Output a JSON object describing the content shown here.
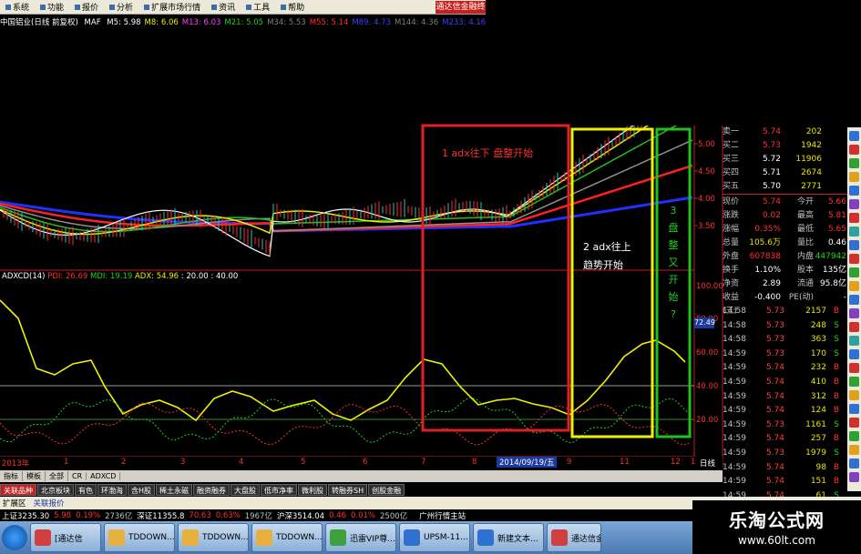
{
  "menu": {
    "items": [
      "系统",
      "功能",
      "报价",
      "分析",
      "扩展市场行情",
      "资讯",
      "工具",
      "帮助"
    ],
    "promo": "通达信金融终"
  },
  "ma_bar": {
    "title": "中国铝业(日线 前复权)",
    "type": "MAF",
    "items": [
      {
        "label": "M5: 5.98",
        "color": "#ffffff"
      },
      {
        "label": "M8: 6.06",
        "color": "#f0f000"
      },
      {
        "label": "M13: 6.03",
        "color": "#ff40ff"
      },
      {
        "label": "M21: 5.05",
        "color": "#20d020"
      },
      {
        "label": "M34: 5.53",
        "color": "#808080"
      },
      {
        "label": "M55: 5.14",
        "color": "#ff3030"
      },
      {
        "label": "M89: 4.73",
        "color": "#4040ff"
      },
      {
        "label": "M144: 4.36",
        "color": "#808080"
      },
      {
        "label": "M233: 4.16",
        "color": "#4040ff"
      }
    ]
  },
  "indicator": {
    "name": "ADXCD(14)",
    "pdi": "PDI: 26.69",
    "mdi": "MDI: 19.19",
    "adx": "ADX: 54.96",
    "extra": ": 20.00 : 40.00",
    "current": "72.49"
  },
  "annotations": {
    "a1": "1 adx往下 盘整开始",
    "a2_line1": "2 adx往上",
    "a2_line2": "趋势开始",
    "a3": [
      "3",
      "盘",
      "整",
      "又",
      "开",
      "始",
      "?"
    ]
  },
  "price_axis": [
    "5.00",
    "4.50",
    "4.00",
    "3.50"
  ],
  "ind_axis": [
    "100.00",
    "80.00",
    "60.00",
    "40.00",
    "20.00"
  ],
  "quotes": [
    {
      "k": "卖一",
      "p": "5.74",
      "v": "202",
      "pc": "#ff3030"
    },
    {
      "k": "买二",
      "p": "5.73",
      "v": "1942",
      "pc": "#ff3030"
    },
    {
      "k": "买三",
      "p": "5.72",
      "v": "11906",
      "pc": "#ffffff"
    },
    {
      "k": "买四",
      "p": "5.71",
      "v": "2674",
      "pc": "#ffffff"
    },
    {
      "k": "买五",
      "p": "5.70",
      "v": "2771",
      "pc": "#ffffff"
    }
  ],
  "stats": [
    {
      "k": "现价",
      "v": "5.74",
      "k2": "今开",
      "v2": "5.66"
    },
    {
      "k": "涨跌",
      "v": "0.02",
      "k2": "最高",
      "v2": "5.81"
    },
    {
      "k": "涨幅",
      "v": "0.35%",
      "k2": "最低",
      "v2": "5.65"
    },
    {
      "k": "总量",
      "v": "105.6万",
      "k2": "量比",
      "v2": "0.46"
    },
    {
      "k": "外盘",
      "v": "607838",
      "k2": "内盘",
      "v2": "447942"
    },
    {
      "k": "换手",
      "v": "1.10%",
      "k2": "股本",
      "v2": "135亿"
    },
    {
      "k": "净资",
      "v": "2.89",
      "k2": "流通",
      "v2": "95.8亿"
    },
    {
      "k": "收益(三)",
      "v": "-0.400",
      "k2": "PE(动)",
      "v2": "-"
    }
  ],
  "trades": [
    {
      "t": "14:58",
      "p": "5.73",
      "v": "2157",
      "s": "B"
    },
    {
      "t": "14:58",
      "p": "5.73",
      "v": "248",
      "s": "S"
    },
    {
      "t": "14:58",
      "p": "5.73",
      "v": "363",
      "s": "S"
    },
    {
      "t": "14:59",
      "p": "5.73",
      "v": "170",
      "s": "S"
    },
    {
      "t": "14:59",
      "p": "5.74",
      "v": "232",
      "s": "B"
    },
    {
      "t": "14:59",
      "p": "5.74",
      "v": "410",
      "s": "B"
    },
    {
      "t": "14:59",
      "p": "5.74",
      "v": "312",
      "s": "B"
    },
    {
      "t": "14:59",
      "p": "5.74",
      "v": "124",
      "s": "B"
    },
    {
      "t": "14:59",
      "p": "5.73",
      "v": "1161",
      "s": "S"
    },
    {
      "t": "14:59",
      "p": "5.74",
      "v": "257",
      "s": "B"
    },
    {
      "t": "14:59",
      "p": "5.73",
      "v": "1979",
      "s": "S"
    },
    {
      "t": "14:59",
      "p": "5.74",
      "v": "98",
      "s": "B"
    },
    {
      "t": "14:59",
      "p": "5.74",
      "v": "151",
      "s": "B"
    },
    {
      "t": "14:59",
      "p": "5.74",
      "v": "61",
      "s": "S"
    }
  ],
  "date_axis": {
    "start": "2013年",
    "months": [
      "1",
      "2",
      "3",
      "4",
      "5",
      "6",
      "7",
      "8",
      "9",
      "11",
      "12",
      "1"
    ],
    "cursor_date": "2014/09/19/五",
    "period": "日线"
  },
  "tabs1": [
    "指标",
    "模板",
    "全部",
    "CR",
    "ADXCD"
  ],
  "tabs2": [
    "关联品种",
    "北京板块",
    "有色",
    "环渤海",
    "含H股",
    "稀土永磁",
    "融资融券",
    "大盘股",
    "低市净率",
    "微利股",
    "转融券SH",
    "创股金融"
  ],
  "tabs3": [
    "扩展区",
    "关联报价"
  ],
  "status": [
    {
      "text": "上证3235.30",
      "color": "#ffffff"
    },
    {
      "text": "5.98",
      "color": "#ff3030"
    },
    {
      "text": "0.19%",
      "color": "#ff3030"
    },
    {
      "text": "2736亿",
      "color": "#c0c0c0"
    },
    {
      "text": "深证11355.8",
      "color": "#ffffff"
    },
    {
      "text": "70.63",
      "color": "#ff3030"
    },
    {
      "text": "0.63%",
      "color": "#ff3030"
    },
    {
      "text": "1967亿",
      "color": "#c0c0c0"
    },
    {
      "text": "沪深3514.04",
      "color": "#ffffff"
    },
    {
      "text": "0.46",
      "color": "#ff3030"
    },
    {
      "text": "0.01%",
      "color": "#ff3030"
    },
    {
      "text": "2500亿",
      "color": "#c0c0c0"
    },
    {
      "text": "广州行情主站",
      "color": "#ffffff"
    }
  ],
  "taskbar": [
    {
      "label": "[通达信",
      "icon": "#d04040"
    },
    {
      "label": "TDDOWN...",
      "icon": "#e8b040"
    },
    {
      "label": "TDDOWN...",
      "icon": "#e8b040"
    },
    {
      "label": "TDDOWN...",
      "icon": "#e8b040"
    },
    {
      "label": "迅雷VIP尊...",
      "icon": "#40a040"
    },
    {
      "label": "UPSM-11...",
      "icon": "#3070d0"
    },
    {
      "label": "新建文本...",
      "icon": "#3070d0"
    },
    {
      "label": "通达信金",
      "icon": "#d04040"
    }
  ],
  "watermark": {
    "line1": "乐淘公式网",
    "line2": "www.60lt.com"
  }
}
